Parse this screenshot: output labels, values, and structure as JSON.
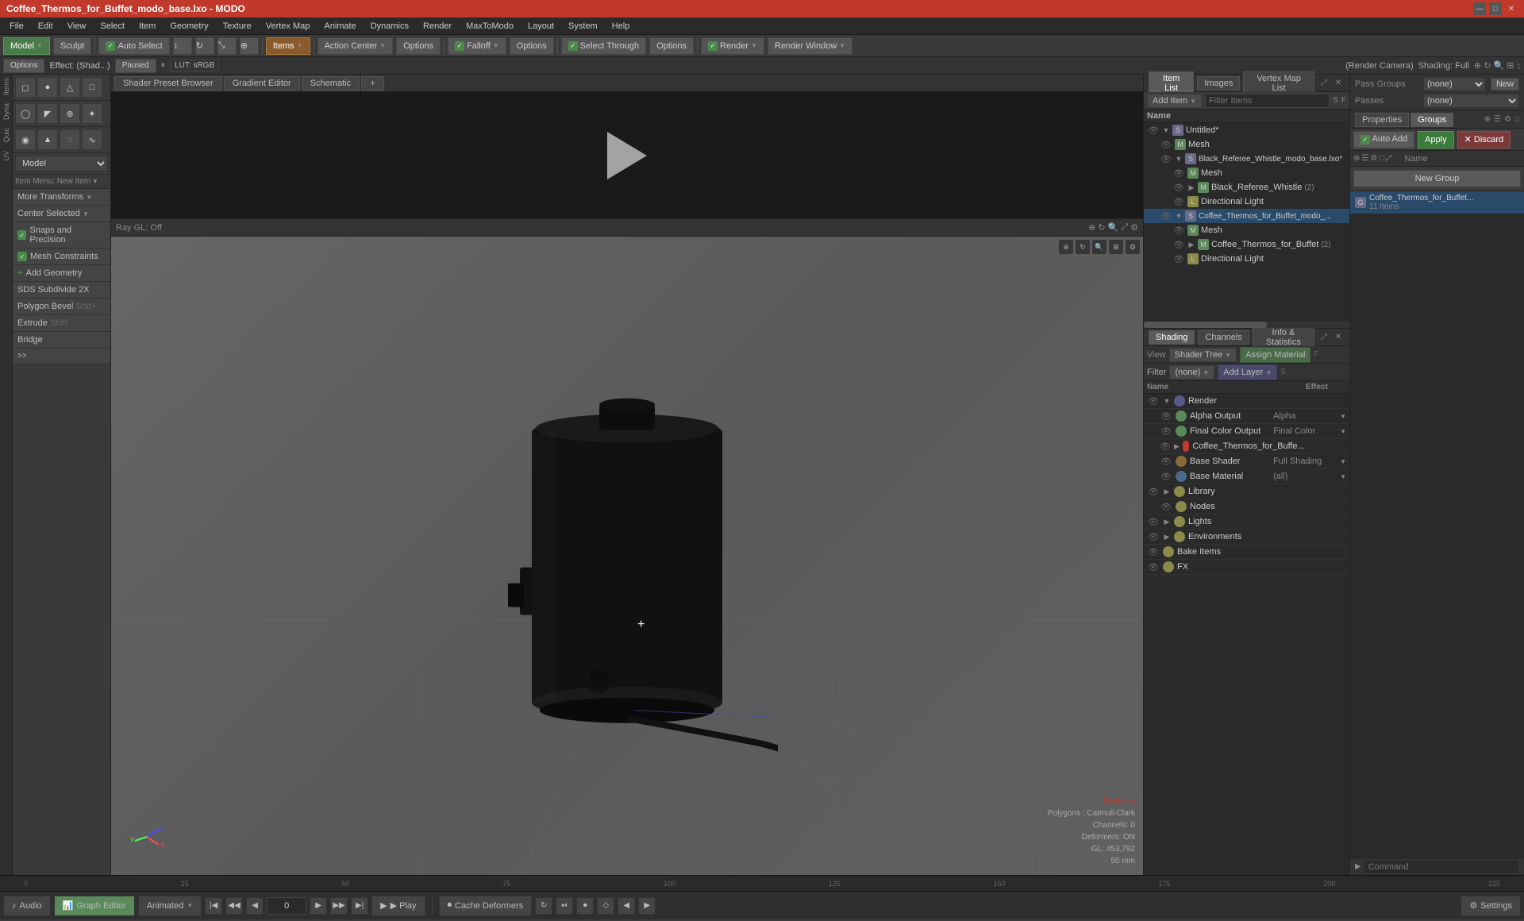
{
  "titleBar": {
    "title": "Coffee_Thermos_for_Buffet_modo_base.lxo - MODO",
    "controls": [
      "—",
      "□",
      "✕"
    ]
  },
  "menuBar": {
    "items": [
      "File",
      "Edit",
      "View",
      "Select",
      "Item",
      "Geometry",
      "Texture",
      "Vertex Map",
      "Animate",
      "Dynamics",
      "Render",
      "MaxToModo",
      "Layout",
      "System",
      "Help"
    ]
  },
  "toolbar": {
    "modelBtn": "Model",
    "sculptBtn": "Sculpt",
    "autoSelectBtn": "Auto Select",
    "itemsBtn": "Items",
    "actionCenterBtn": "Action Center",
    "optionsBtn1": "Options",
    "falloffBtn": "Falloff",
    "optionsBtn2": "Options",
    "selectThroughBtn": "Select Through",
    "optionsBtn3": "Options",
    "renderBtn": "Render",
    "renderWindowBtn": "Render Window"
  },
  "secondaryToolbar": {
    "optionsBtn": "Options",
    "effect": "Effect: (Shad...)",
    "pausedBtn": "Paused",
    "lut": "LUT: sRGB",
    "renderCameraLabel": "(Render Camera)",
    "shadingLabel": "Shading: Full"
  },
  "leftPanel": {
    "iconRows": [
      "◼",
      "●",
      "△",
      "◻",
      "◯",
      "◤",
      "⊕",
      "✦",
      "◉",
      "▲"
    ],
    "moreTransforms": "More Transforms",
    "centerSelected": "Center Selected",
    "snapsAndPrecision": "Snaps and Precision",
    "meshConstraints": "Mesh Constraints",
    "addGeometry": "Add Geometry",
    "sdsSubdivide2x": "SDS Subdivide 2X",
    "polygonBevel": "Polygon Bevel",
    "extrude": "Extrude",
    "bridge": "Bridge",
    "moreBtn": ">>"
  },
  "viewportTabs": {
    "tabs": [
      "Shader Preset Browser",
      "Gradient Editor",
      "Schematic",
      "+"
    ]
  },
  "viewport": {
    "rayGL": "Ray GL: Off",
    "noItems": "No Items",
    "polygons": "Polygons : Catmull-Clark",
    "channels": "Channels: 0",
    "deformers": "Deformers: ON",
    "gl": "GL: 453,792",
    "mm": "50 mm"
  },
  "itemListPanel": {
    "tabs": [
      "Item List",
      "Images",
      "Vertex Map List"
    ],
    "addItemBtn": "Add Item",
    "filterItemsPlaceholder": "Filter Items",
    "colName": "Name",
    "colS": "S",
    "colF": "F",
    "items": [
      {
        "name": "Untitled*",
        "type": "scene",
        "indent": 0
      },
      {
        "name": "Mesh",
        "type": "mesh",
        "indent": 1
      },
      {
        "name": "Black_Referee_Whistle_modo_base.lxo*",
        "type": "scene",
        "indent": 1
      },
      {
        "name": "Mesh",
        "type": "mesh",
        "indent": 2
      },
      {
        "name": "Black_Referee_Whistle",
        "type": "mesh",
        "indent": 2,
        "count": 2
      },
      {
        "name": "Directional Light",
        "type": "light",
        "indent": 2
      },
      {
        "name": "Coffee_Thermos_for_Buffet_modo_...",
        "type": "scene",
        "indent": 1,
        "selected": true
      },
      {
        "name": "Mesh",
        "type": "mesh",
        "indent": 2
      },
      {
        "name": "Coffee_Thermos_for_Buffet",
        "type": "mesh",
        "indent": 2,
        "count": 2
      },
      {
        "name": "Directional Light",
        "type": "light",
        "indent": 2
      }
    ]
  },
  "shadingPanel": {
    "tabs": [
      "Shading",
      "Channels",
      "Info & Statistics"
    ],
    "viewLabel": "View",
    "shaderTree": "Shader Tree",
    "assignMaterialBtn": "Assign Material",
    "filterLabel": "Filter",
    "filterValue": "(none)",
    "addLayerBtn": "Add Layer",
    "colName": "Name",
    "colEffect": "Effect",
    "items": [
      {
        "name": "Render",
        "type": "render",
        "indent": 0,
        "effect": ""
      },
      {
        "name": "Alpha Output",
        "type": "output",
        "indent": 1,
        "effect": "Alpha"
      },
      {
        "name": "Final Color Output",
        "type": "output",
        "indent": 1,
        "effect": "Final Color"
      },
      {
        "name": "Coffee_Thermos_for_Buffe...",
        "type": "material",
        "indent": 1,
        "effect": ""
      },
      {
        "name": "Base Shader",
        "type": "shader",
        "indent": 1,
        "effect": "Full Shading"
      },
      {
        "name": "Base Material",
        "type": "base",
        "indent": 1,
        "effect": "(all)"
      },
      {
        "name": "Library",
        "type": "folder",
        "indent": 0,
        "effect": ""
      },
      {
        "name": "Nodes",
        "type": "folder",
        "indent": 1,
        "effect": ""
      },
      {
        "name": "Lights",
        "type": "folder",
        "indent": 0,
        "effect": ""
      },
      {
        "name": "Environments",
        "type": "folder",
        "indent": 0,
        "effect": ""
      },
      {
        "name": "Bake Items",
        "type": "folder",
        "indent": 0,
        "effect": ""
      },
      {
        "name": "FX",
        "type": "folder",
        "indent": 0,
        "effect": ""
      }
    ]
  },
  "groupsPanel": {
    "tabProperties": "Properties",
    "tabGroups": "Groups",
    "autoAddBtn": "Auto Add",
    "applyBtn": "Apply",
    "discardBtn": "Discard",
    "colIcon": "",
    "colName": "Name",
    "newGroupBtn": "New Group",
    "items": [
      {
        "name": "Coffee_Thermos_for_Buffet...",
        "count": "11 Items"
      }
    ],
    "commandLabel": "Command"
  },
  "bottomTimeline": {
    "ticks": [
      "0",
      "25",
      "50",
      "75",
      "100",
      "125",
      "150",
      "175",
      "200",
      "225"
    ]
  },
  "statusBar": {
    "audioBtn": "Audio",
    "graphEditorBtn": "Graph Editor",
    "animatedBtn": "Animated",
    "prevKeyBtn": "◀◀",
    "prevFrameBtn": "◀",
    "frameValue": "0",
    "nextFrameBtn": "▶",
    "nextKeyBtn": "▶▶",
    "playBtn": "▶ Play",
    "cacheDeformersBtn": "Cache Deformers",
    "settingsBtn": "Settings"
  }
}
